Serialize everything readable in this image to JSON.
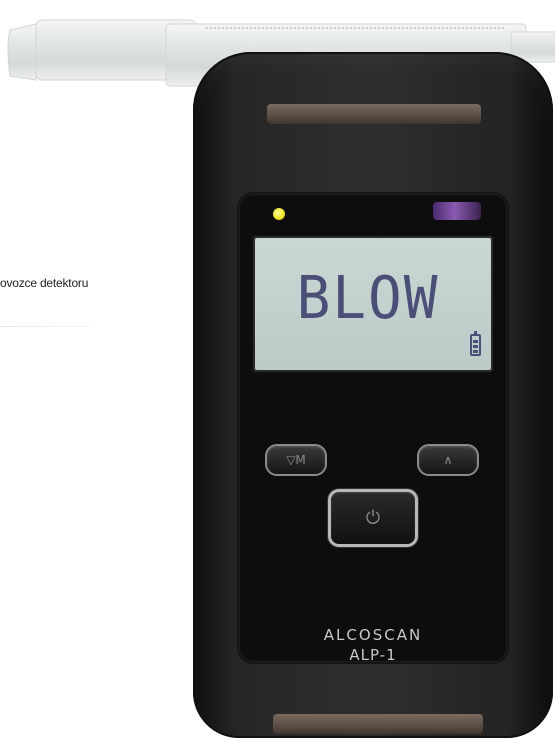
{
  "caption": "ovozce detektoru",
  "device": {
    "display_text": "BLOW",
    "brand": "ALCOSCAN",
    "model": "ALP-1",
    "buttons": {
      "menu_glyph": "▽M",
      "up_glyph": "∧",
      "power_glyph": "⏻"
    },
    "icons": [
      "battery-icon",
      "status-led-icon",
      "sensor-window"
    ],
    "colors": {
      "body": "#2b2b2b",
      "lcd": "#c4d0cd",
      "lcd_text": "#4b4f78",
      "led": "#f1e82a"
    }
  }
}
